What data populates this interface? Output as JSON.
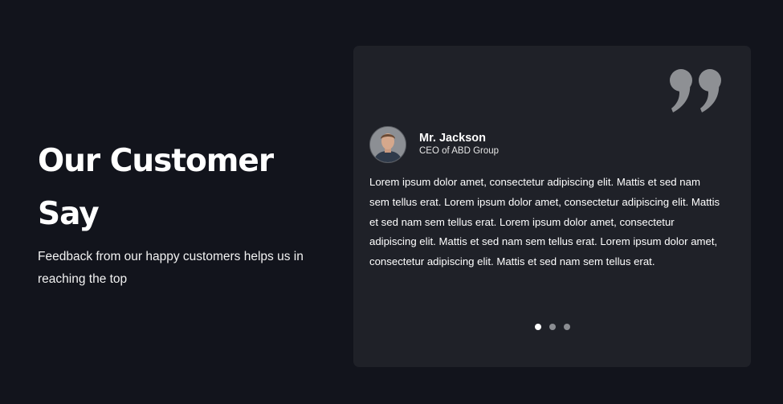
{
  "section": {
    "title_line1": "Our Customer",
    "title_line2": "Say",
    "subtitle": "Feedback from our happy customers helps us in reaching the top"
  },
  "testimonial": {
    "author_name": "Mr. Jackson",
    "author_role": "CEO of ABD Group",
    "text": "Lorem ipsum dolor amet, consectetur adipiscing elit. Mattis et sed nam sem tellus erat. Lorem ipsum dolor amet, consectetur adipiscing elit. Mattis et sed nam sem tellus erat. Lorem ipsum dolor amet, consectetur adipiscing elit. Mattis et sed nam sem tellus erat. Lorem ipsum dolor amet, consectetur adipiscing elit. Mattis et sed nam sem tellus erat.",
    "quote_icon": "quote-icon",
    "avatar_icon": "avatar"
  },
  "pagination": {
    "total": 3,
    "active": 1
  },
  "colors": {
    "background": "#12141c",
    "card": "#1f2128",
    "quote": "#8e9094",
    "dot_inactive": "#8b8d92",
    "dot_active": "#ffffff"
  }
}
